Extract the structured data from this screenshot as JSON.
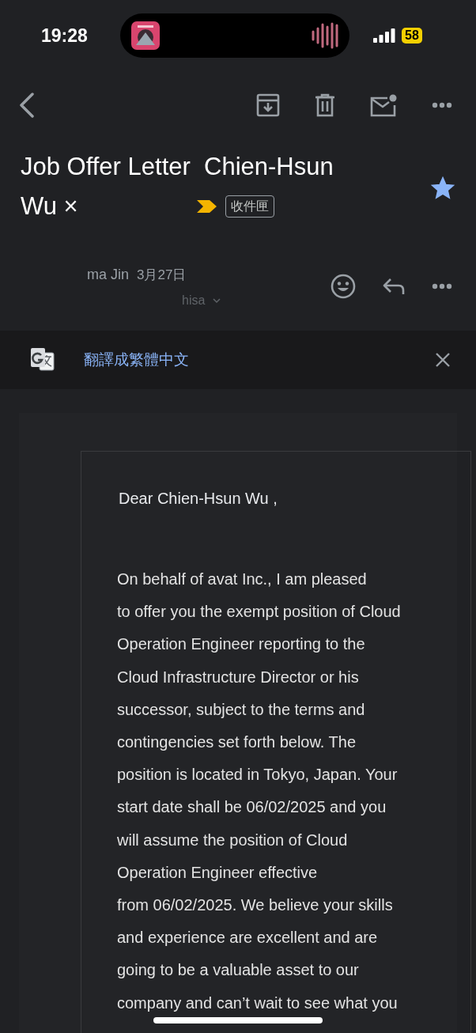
{
  "status_bar": {
    "time": "19:28",
    "battery": "58"
  },
  "subject": {
    "lines": [
      "Job Offer Letter  Chien-Hsun",
      "Wu ×"
    ],
    "important": true,
    "label": "收件匣",
    "starred": true
  },
  "sender": {
    "name": "ma Jin",
    "date": "3月27日",
    "recipient": "hisa"
  },
  "translate_bar": {
    "text": "翻譯成繁體中文"
  },
  "letter": {
    "greeting": "Dear Chien-Hsun Wu ,",
    "paragraph": [
      "On behalf of avat  Inc., I am pleased",
      "to offer you the exempt position of Cloud",
      "Operation Engineer reporting to the",
      "Cloud Infrastructure Director or his",
      "successor, subject to the terms and",
      "contingencies set forth below. The",
      "position is located in Tokyo, Japan. Your",
      "start date shall be 06/02/2025 and you",
      "will assume the position of Cloud",
      "Operation Engineer effective",
      "from 06/02/2025. We believe your skills",
      "and experience are excellent and are",
      "going to be a valuable asset to our",
      "company and can’t wait to see what you"
    ]
  }
}
